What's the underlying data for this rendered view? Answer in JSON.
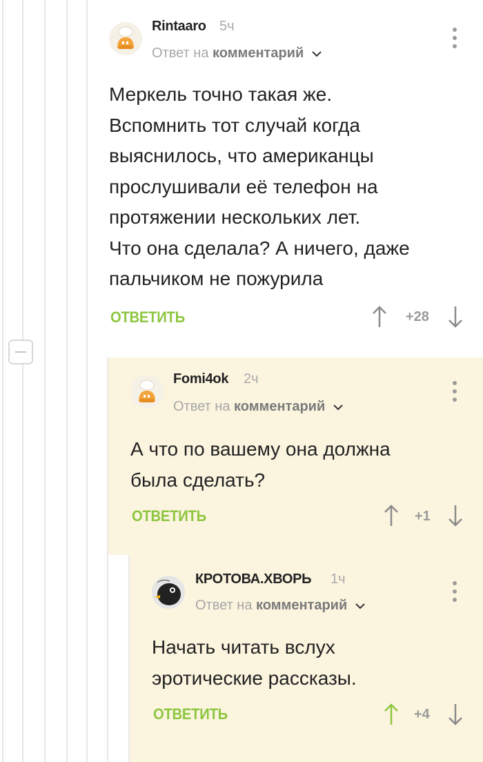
{
  "comments": [
    {
      "author": "Rintaaro",
      "time": "5ч",
      "reply_prefix": "Ответ на",
      "reply_target": "комментарий",
      "text": "Меркель точно такая же.\nВспомнить тот случай когда\nвыяснилось, что американцы\nпрослушивали её телефон на\nпротяжении нескольких лет.\nЧто она сделала? А ничего, даже\nпальчиком не пожурила",
      "reply_label": "ОТВЕТИТЬ",
      "score": "+28",
      "upvoted": false
    },
    {
      "author": "Fomi4ok",
      "time": "2ч",
      "reply_prefix": "Ответ на",
      "reply_target": "комментарий",
      "text": "А что по вашему она должна\nбыла сделать?",
      "reply_label": "ОТВЕТИТЬ",
      "score": "+1",
      "upvoted": false
    },
    {
      "author": "КРОТОВА.ХВОРЬ",
      "time": "1ч",
      "reply_prefix": "Ответ на",
      "reply_target": "комментарий",
      "text": "Начать читать вслух\nэротические рассказы.",
      "reply_label": "ОТВЕТИТЬ",
      "score": "+4",
      "upvoted": true
    }
  ],
  "colors": {
    "accent_green": "#8dc63f",
    "reply_background": "#fbf4df",
    "thread_line": "#e8e8e8",
    "vote_arrow": "#8a8a8a"
  },
  "icons": {
    "avatar_default": "hut-avatar-icon",
    "avatar_custom": "bird-avatar-icon",
    "menu": "kebab-menu-icon",
    "expand": "chevron-down-icon",
    "upvote": "arrow-up-icon",
    "downvote": "arrow-down-icon",
    "collapse": "minus-icon"
  }
}
